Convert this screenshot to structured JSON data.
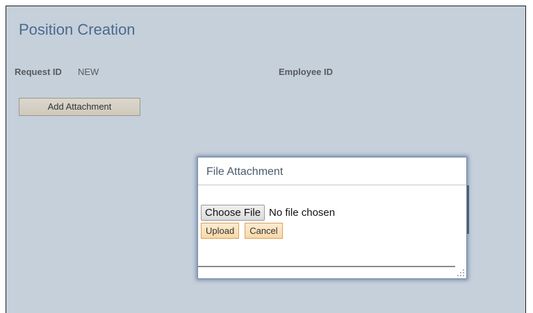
{
  "page": {
    "title": "Position Creation",
    "request_id_label": "Request ID",
    "request_id_value": "NEW",
    "employee_id_label": "Employee ID",
    "add_attachment_label": "Add Attachment"
  },
  "modal": {
    "title": "File Attachment",
    "choose_file_label": "Choose File",
    "no_file_text": "No file chosen",
    "upload_label": "Upload",
    "cancel_label": "Cancel",
    "resize_icon": "resize-grip-icon"
  },
  "colors": {
    "page_background": "#c6d0da",
    "title_color": "#4a6a8e",
    "button_orange": "#f7d8a8"
  }
}
